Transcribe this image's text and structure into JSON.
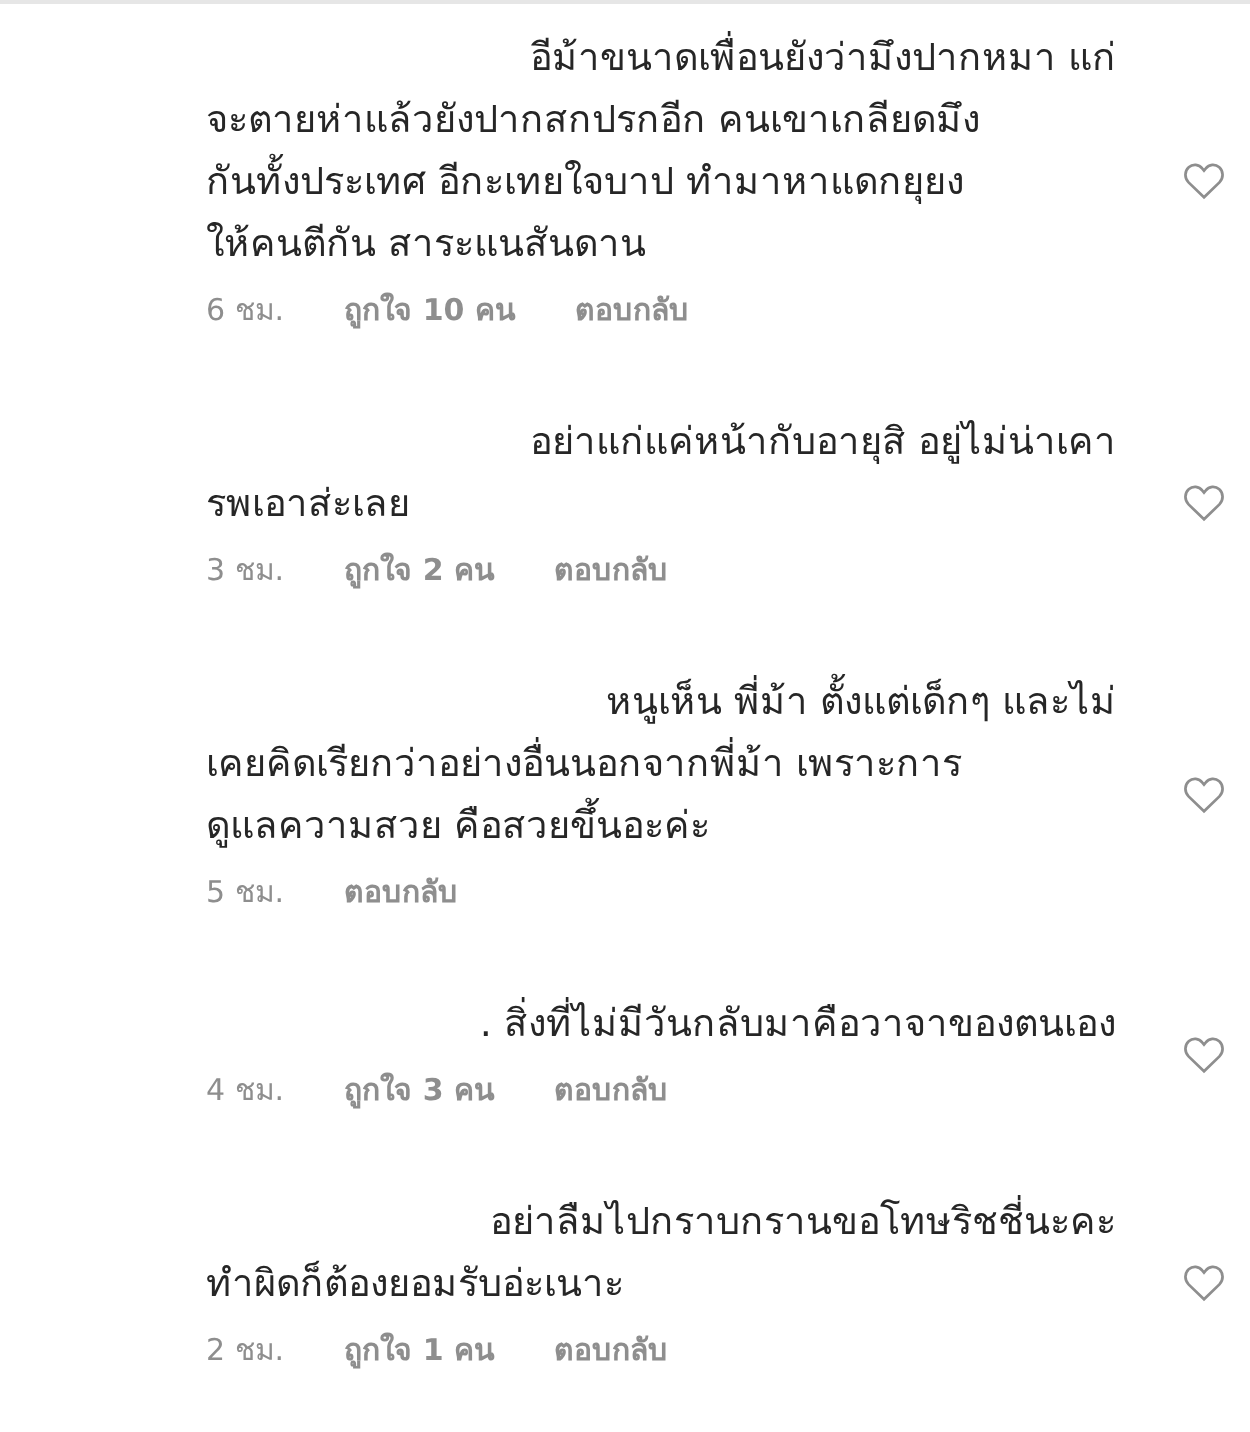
{
  "comments": [
    {
      "lines": [
        "อีม้าขนาดเพื่อนยังว่ามึงปากหมา แก่",
        "จะตายห่าแล้วยังปากสกปรกอีก คนเขาเกลียดมึง",
        "กันทั้งประเทศ อีกะเทยใจบาป  ทำมาหาแดกยุยง",
        "ให้คนตีกัน สาระแนสันดาน"
      ],
      "time": "6 ชม.",
      "likes": "ถูกใจ 10 คน",
      "reply": "ตอบกลับ"
    },
    {
      "lines": [
        "อย่าแก่แค่หน้ากับอายุสิ อยู่ไม่น่าเคา",
        "รพเอาส่ะเลย"
      ],
      "time": "3 ชม.",
      "likes": "ถูกใจ 2 คน",
      "reply": "ตอบกลับ"
    },
    {
      "lines": [
        "หนูเห็น พี่ม้า ตั้งแต่เด็กๆ และไม่",
        "เคยคิดเรียกว่าอย่างอื่นนอกจากพี่ม้า  เพราะการ",
        "ดูแลความสวย  คือสวยขึ้นอะค่ะ"
      ],
      "time": "5 ชม.",
      "reply": "ตอบกลับ"
    },
    {
      "lines": [
        ". สิ่งที่ไม่มีวันกลับมาคือวาจาของตนเอง"
      ],
      "time": "4 ชม.",
      "likes": "ถูกใจ 3 คน",
      "reply": "ตอบกลับ"
    },
    {
      "lines": [
        "อย่าลืมไปกราบกรานขอโทษริชชี่นะคะ",
        "ทำผิดก็ต้องยอมรับอ่ะเนาะ"
      ],
      "time": "2 ชม.",
      "likes": "ถูกใจ 1 คน",
      "reply": "ตอบกลับ"
    }
  ]
}
